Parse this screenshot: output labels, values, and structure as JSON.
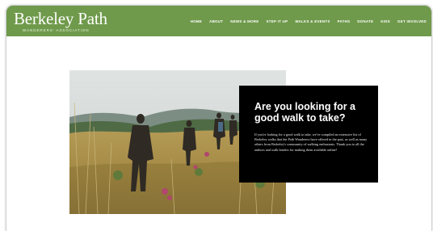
{
  "site": {
    "name": "Berkeley Path",
    "subtitle": "WANDERERS' ASSOCIATION",
    "brand_color": "#6f9a4b"
  },
  "nav": {
    "items": [
      {
        "label": "HOME"
      },
      {
        "label": "ABOUT"
      },
      {
        "label": "NEWS & MORE"
      },
      {
        "label": "STEP IT UP"
      },
      {
        "label": "WALKS & EVENTS"
      },
      {
        "label": "PATHS"
      },
      {
        "label": "DONATE"
      },
      {
        "label": "KIDS"
      },
      {
        "label": "GET INVOLVED"
      }
    ]
  },
  "hero": {
    "heading": "Are you looking for a good walk to take?",
    "body": "If you're looking for a good walk to take, we've compiled an extensive list of Berkeley walks that the Path Wanderers have offered in the past, as well as many others from Berkeley's community of walking enthusiasts. Thank you to all the authors and walk leaders for making them available online!"
  }
}
